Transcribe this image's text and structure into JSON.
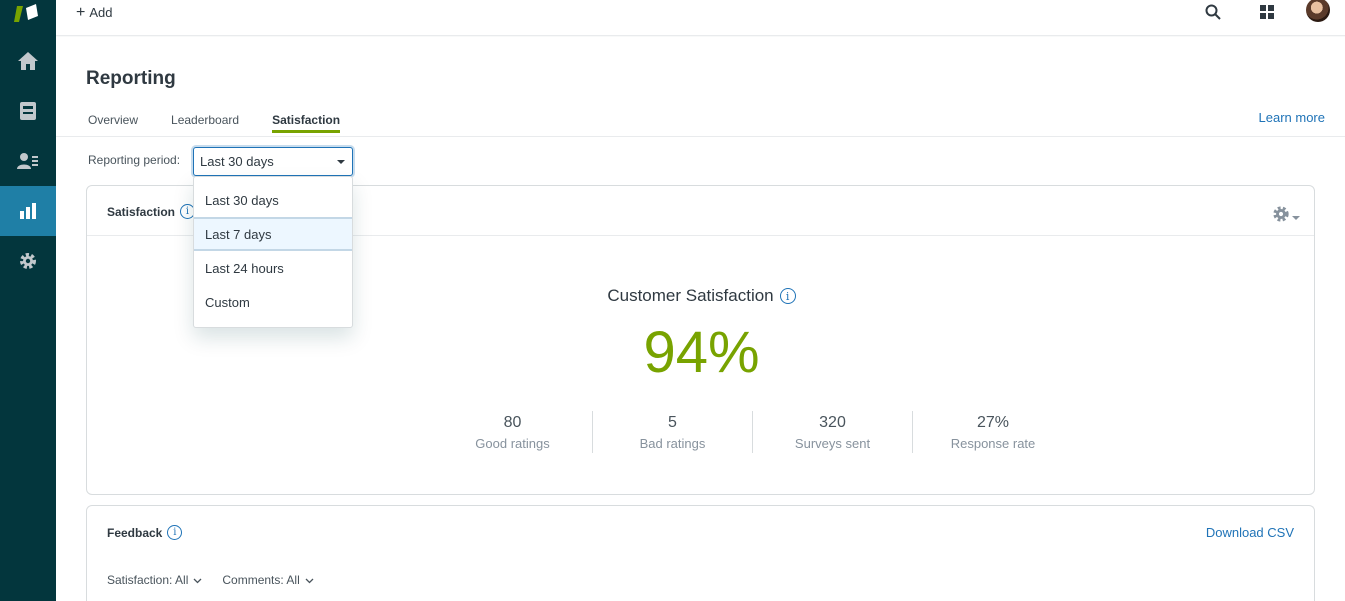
{
  "topbar": {
    "add_label": "Add",
    "icons": [
      "search-icon",
      "apps-grid-icon",
      "avatar"
    ]
  },
  "sidebar": {
    "items": [
      {
        "icon": "home-icon",
        "active": false
      },
      {
        "icon": "views-icon",
        "active": false
      },
      {
        "icon": "customers-icon",
        "active": false
      },
      {
        "icon": "reporting-icon",
        "active": true
      },
      {
        "icon": "admin-gear-icon",
        "active": false
      }
    ],
    "active_color": "#1f7fa6"
  },
  "page": {
    "title": "Reporting",
    "tabs": [
      {
        "label": "Overview",
        "active": false
      },
      {
        "label": "Leaderboard",
        "active": false
      },
      {
        "label": "Satisfaction",
        "active": true
      }
    ],
    "learn_more": "Learn more"
  },
  "period": {
    "label": "Reporting period:",
    "selected": "Last 30 days",
    "options": [
      "Last 30 days",
      "Last 7 days",
      "Last 24 hours",
      "Custom"
    ],
    "highlighted": "Last 7 days"
  },
  "satisfaction_card": {
    "title": "Satisfaction",
    "heading": "Customer Satisfaction",
    "value": "94%",
    "value_color": "#78a300",
    "stats": [
      {
        "value": "80",
        "label": "Good ratings"
      },
      {
        "value": "5",
        "label": "Bad ratings"
      },
      {
        "value": "320",
        "label": "Surveys sent"
      },
      {
        "value": "27%",
        "label": "Response rate"
      }
    ]
  },
  "feedback_card": {
    "title": "Feedback",
    "download": "Download CSV",
    "filters": [
      {
        "label": "Satisfaction: All"
      },
      {
        "label": "Comments: All"
      }
    ]
  },
  "colors": {
    "sidebar_bg": "#03363d",
    "accent_green": "#78a300",
    "link_blue": "#1f73b7"
  }
}
